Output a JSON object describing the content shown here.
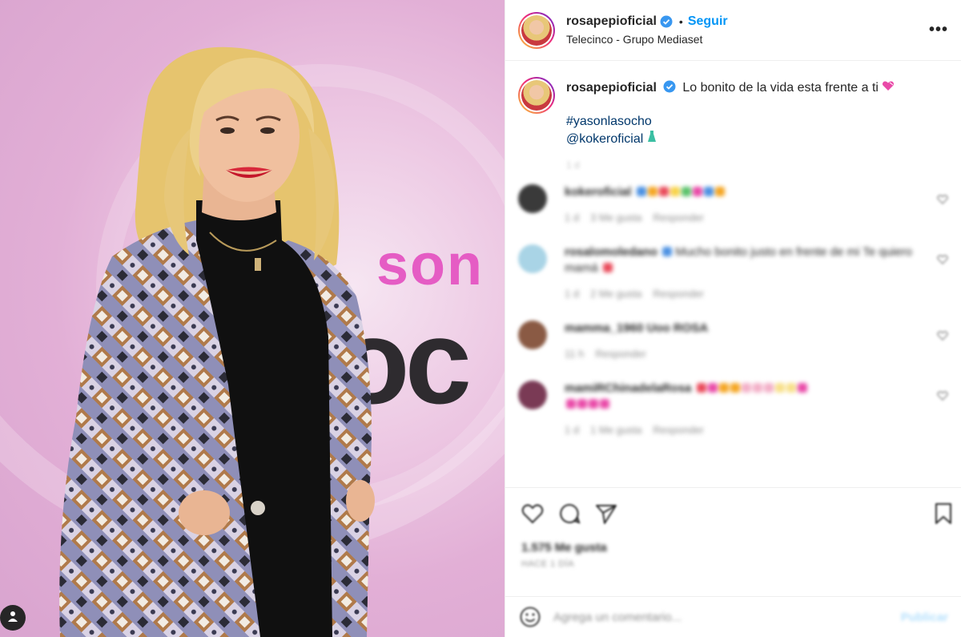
{
  "post": {
    "username": "rosapepioficial",
    "follow_label": "Seguir",
    "dot": "•",
    "location": "Telecinco - Grupo Mediaset",
    "more_label": "•••"
  },
  "photo": {
    "bg_word_top": "son",
    "bg_word_bottom": "oc"
  },
  "caption": {
    "username": "rosapepioficial",
    "text": "Lo bonito de la vida esta frente a ti",
    "hashtag": "#yasonlasocho",
    "mention": "@kokeroficial",
    "time": "1 d"
  },
  "comments": [
    {
      "username": "kokeroficial",
      "text": "",
      "time": "1 d",
      "likes": "3 Me gusta",
      "reply": "Responder",
      "avatar_color": "#3a3a3a"
    },
    {
      "username": "rosalomoledano",
      "text": "Mucho bonito justo en frente de mi Te quiero mamá",
      "time": "1 d",
      "likes": "2 Me gusta",
      "reply": "Responder",
      "avatar_color": "#a9d4e6"
    },
    {
      "username": "mamma_1960 Uoo ROSA",
      "text": "",
      "time": "11 h",
      "likes": "",
      "reply": "Responder",
      "avatar_color": "#8a5a44"
    },
    {
      "username": "mamiRChinadelaRosa",
      "text": "",
      "time": "1 d",
      "likes": "1 Me gusta",
      "reply": "Responder",
      "avatar_color": "#7a3a55"
    }
  ],
  "actions": {
    "likes_text": "1.575 Me gusta",
    "date_text": "HACE 1 DÍA"
  },
  "add_comment": {
    "placeholder": "Agrega un comentario...",
    "publish_label": "Publicar"
  },
  "colors": {
    "link_blue": "#0095f6",
    "hashtag_blue": "#00376b",
    "border": "#efefef",
    "brand_pink": "#e55cc4"
  },
  "icons": [
    "verified-icon",
    "heart-icon",
    "comment-icon",
    "share-icon",
    "bookmark-icon",
    "emoji-icon",
    "more-icon",
    "user-tag-icon",
    "gem-heart-emoji",
    "dress-emoji"
  ]
}
